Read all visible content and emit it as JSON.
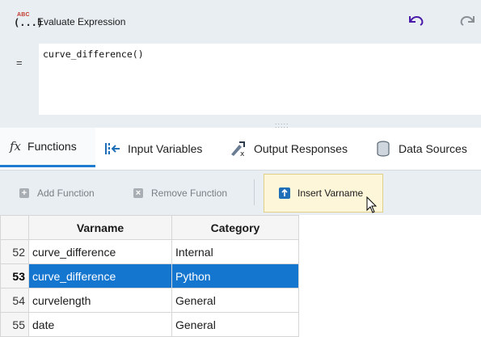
{
  "header": {
    "title": "Evaluate Expression",
    "icon_text": "ABC",
    "icon_parens": "(...)"
  },
  "editor": {
    "equals": "=",
    "expression": "curve_difference()"
  },
  "tabs": [
    {
      "label": "Functions",
      "icon": "function-icon",
      "active": true
    },
    {
      "label": "Input Variables",
      "icon": "input-variables-icon"
    },
    {
      "label": "Output Responses",
      "icon": "output-responses-icon"
    },
    {
      "label": "Data Sources",
      "icon": "database-icon"
    }
  ],
  "toolbar": {
    "add_function": "Add Function",
    "remove_function": "Remove Function",
    "insert_varname": "Insert Varname"
  },
  "table": {
    "columns": [
      "Varname",
      "Category"
    ],
    "rows": [
      {
        "num": "52",
        "varname": "curve_difference",
        "category": "Internal"
      },
      {
        "num": "53",
        "varname": "curve_difference",
        "category": "Python",
        "selected": true
      },
      {
        "num": "54",
        "varname": "curvelength",
        "category": "General"
      },
      {
        "num": "55",
        "varname": "date",
        "category": "General"
      }
    ]
  },
  "colors": {
    "accent": "#1576d0",
    "undo_icon": "#4a1ba8",
    "highlight": "#fdf6d8"
  }
}
